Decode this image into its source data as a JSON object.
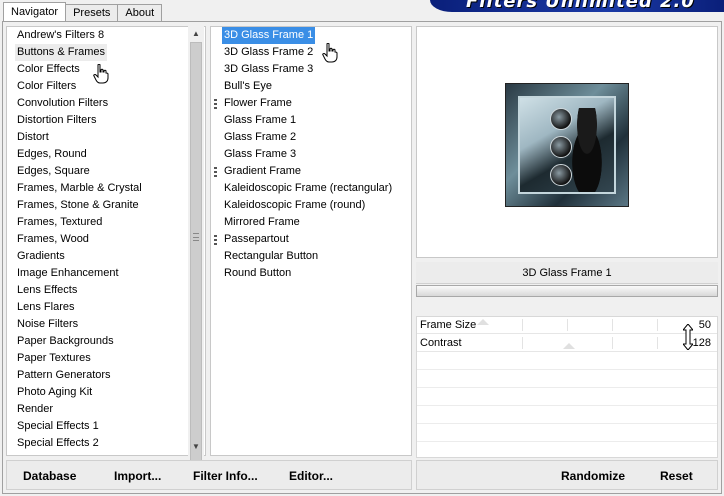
{
  "tabs": [
    {
      "label": "Navigator"
    },
    {
      "label": "Presets"
    },
    {
      "label": "About"
    }
  ],
  "banner": {
    "text": "Filters Unlimited 2.0"
  },
  "categories": [
    "Andrew's Filters 8",
    "Buttons & Frames",
    "Color Effects",
    "Color Filters",
    "Convolution Filters",
    "Distortion Filters",
    "Distort",
    "Edges, Round",
    "Edges, Square",
    "Frames, Marble & Crystal",
    "Frames, Stone & Granite",
    "Frames, Textured",
    "Frames, Wood",
    "Gradients",
    "Image Enhancement",
    "Lens Effects",
    "Lens Flares",
    "Noise Filters",
    "Paper Backgrounds",
    "Paper Textures",
    "Pattern Generators",
    "Photo Aging Kit",
    "Render",
    "Special Effects 1",
    "Special Effects 2"
  ],
  "filters": [
    {
      "label": "3D Glass Frame 1",
      "group": false
    },
    {
      "label": "3D Glass Frame 2",
      "group": false
    },
    {
      "label": "3D Glass Frame 3",
      "group": false
    },
    {
      "label": "Bull's Eye",
      "group": false
    },
    {
      "label": "Flower Frame",
      "group": true
    },
    {
      "label": "Glass Frame 1",
      "group": false
    },
    {
      "label": "Glass Frame 2",
      "group": false
    },
    {
      "label": "Glass Frame 3",
      "group": false
    },
    {
      "label": "Gradient Frame",
      "group": true
    },
    {
      "label": "Kaleidoscopic Frame (rectangular)",
      "group": false
    },
    {
      "label": "Kaleidoscopic Frame (round)",
      "group": false
    },
    {
      "label": "Mirrored Frame",
      "group": false
    },
    {
      "label": "Passepartout",
      "group": true
    },
    {
      "label": "Rectangular Button",
      "group": false
    },
    {
      "label": "Round Button",
      "group": false
    }
  ],
  "selected_category": "Buttons & Frames",
  "selected_filter": "3D Glass Frame 1",
  "filter_name": "3D Glass Frame 1",
  "params": [
    {
      "label": "Frame Size",
      "value": "50"
    },
    {
      "label": "Contrast",
      "value": "128"
    }
  ],
  "buttons": {
    "database": "Database",
    "import": "Import...",
    "filter_info": "Filter Info...",
    "editor": "Editor...",
    "randomize": "Randomize",
    "reset": "Reset"
  },
  "colors": {
    "selection": "#3a8ee6",
    "banner": "#1b3aa6"
  }
}
